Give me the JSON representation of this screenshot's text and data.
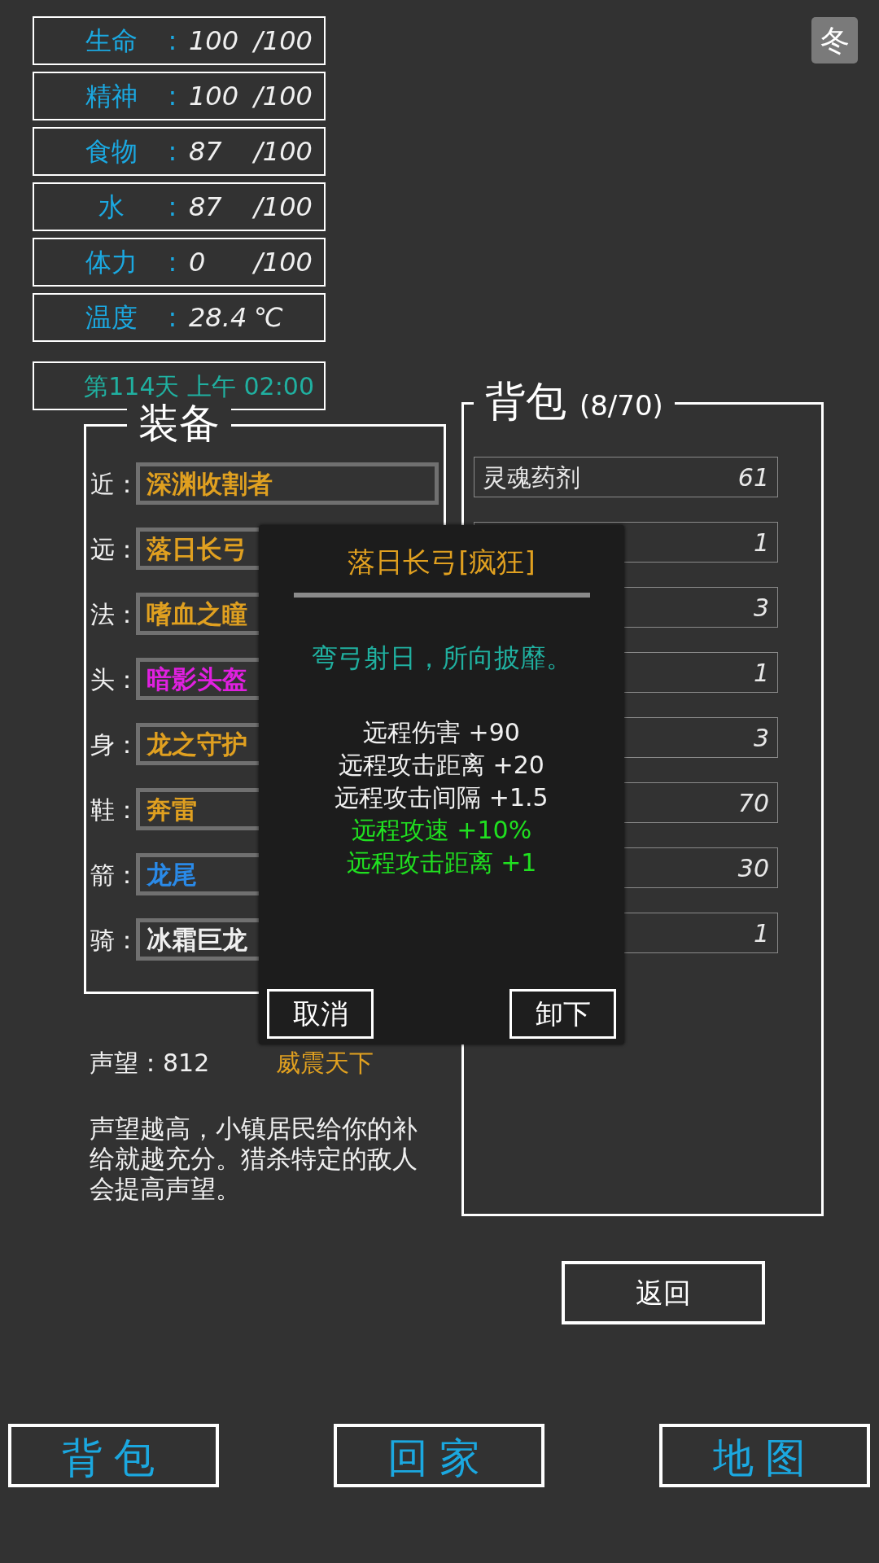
{
  "season": "冬",
  "stats": [
    {
      "label": "生命",
      "separator": ":",
      "value": "100",
      "max": "/100"
    },
    {
      "label": "精神",
      "separator": ":",
      "value": "100",
      "max": "/100"
    },
    {
      "label": "食物",
      "separator": ":",
      "value": "87",
      "max": "/100"
    },
    {
      "label": "水",
      "separator": ":",
      "value": "87",
      "max": "/100"
    },
    {
      "label": "体力",
      "separator": ":",
      "value": "0",
      "max": "/100"
    },
    {
      "label": "温度",
      "separator": ":",
      "value": "28.4",
      "max": "℃"
    }
  ],
  "time": "第114天 上午 02:00",
  "equipment": {
    "title": "装备",
    "slots": [
      {
        "slot": "近：",
        "name": "深渊收割者",
        "kind": "legendary"
      },
      {
        "slot": "远：",
        "name": "落日长弓",
        "kind": "legendary"
      },
      {
        "slot": "法：",
        "name": "嗜血之瞳",
        "kind": "legendary"
      },
      {
        "slot": "头：",
        "name": "暗影头盔",
        "kind": "epic"
      },
      {
        "slot": "身：",
        "name": "龙之守护",
        "kind": "legendary"
      },
      {
        "slot": "鞋：",
        "name": "奔雷",
        "kind": "legendary"
      },
      {
        "slot": "箭：",
        "name": "龙尾",
        "kind": "rare"
      },
      {
        "slot": "骑：",
        "name": "冰霜巨龙",
        "kind": "common"
      }
    ]
  },
  "backpack": {
    "title": "背包",
    "count": "(8/70)",
    "items": [
      {
        "name": "灵魂药剂",
        "qty": "61"
      },
      {
        "qty": "1"
      },
      {
        "qty": "3"
      },
      {
        "qty": "1"
      },
      {
        "qty": "3"
      },
      {
        "qty": "70"
      },
      {
        "qty": "30"
      },
      {
        "qty": "1"
      }
    ]
  },
  "reputation": {
    "label": "声望：812",
    "rank": "威震天下",
    "description": "声望越高，小镇居民给你的补给就越充分。猎杀特定的敌人会提高声望。"
  },
  "popup": {
    "title": "落日长弓[疯狂]",
    "quote": "弯弓射日，所向披靡。",
    "stats": [
      {
        "text": "远程伤害 +90",
        "kind": "base"
      },
      {
        "text": "远程攻击距离 +20",
        "kind": "base"
      },
      {
        "text": "远程攻击间隔 +1.5",
        "kind": "base"
      },
      {
        "text": "远程攻速 +10%",
        "kind": "bonus"
      },
      {
        "text": "远程攻击距离 +1",
        "kind": "bonus"
      }
    ],
    "buttons": [
      "取消",
      "卸下"
    ]
  },
  "return_button": "返回",
  "nav": [
    {
      "label": "背包"
    },
    {
      "label": "回家"
    },
    {
      "label": "地图"
    }
  ]
}
